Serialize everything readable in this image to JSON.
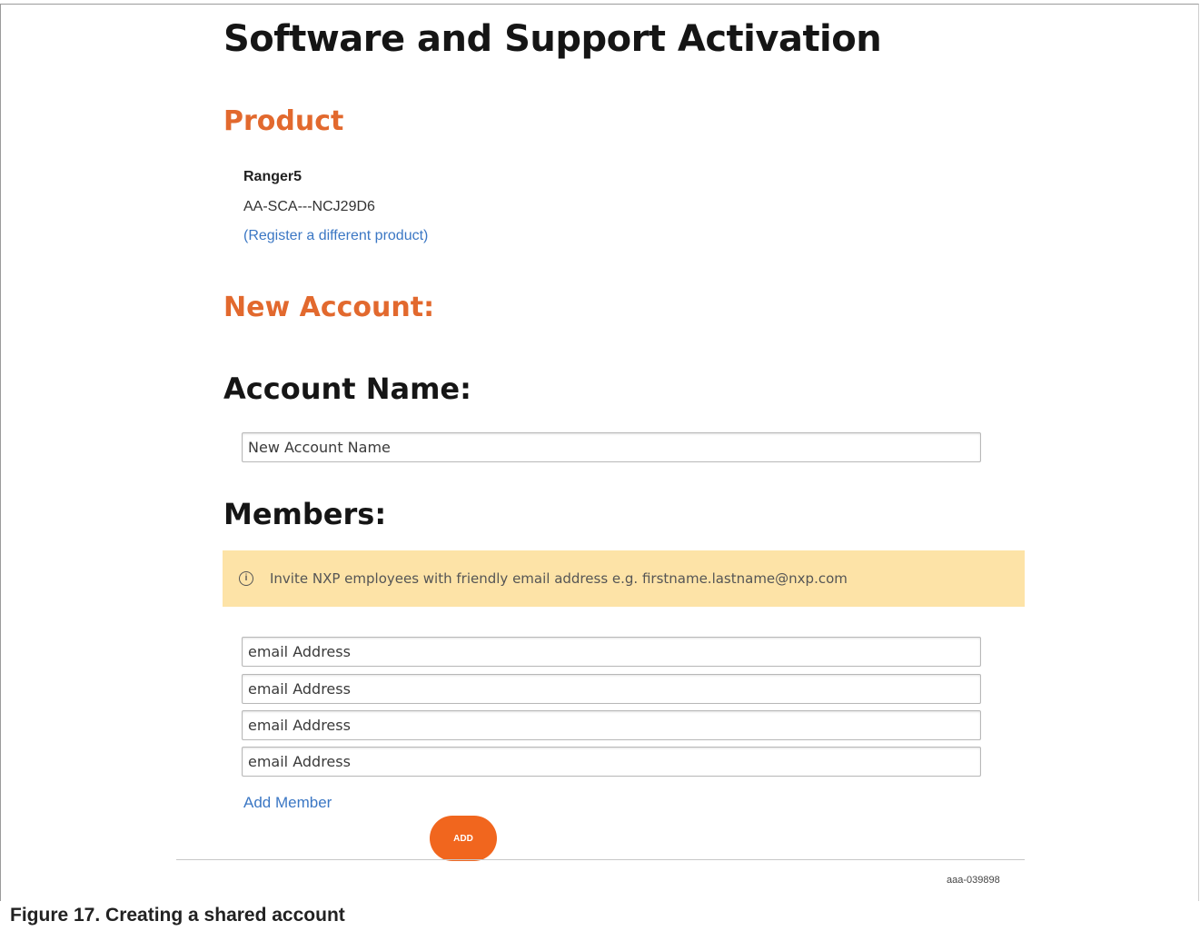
{
  "page": {
    "title": "Software and Support Activation"
  },
  "product": {
    "heading": "Product",
    "name": "Ranger5",
    "code": "AA-SCA---NCJ29D6",
    "change_link": "(Register a different product)"
  },
  "new_account": {
    "heading": "New Account:",
    "account_name_label": "Account Name:",
    "account_name_placeholder": "New Account Name"
  },
  "members": {
    "heading": "Members:",
    "notice_icon": "info-icon",
    "notice_text": "Invite NXP employees with friendly email address e.g. firstname.lastname@nxp.com",
    "email_placeholder": "email Address",
    "add_member_link": "Add Member",
    "add_button_label": "ADD"
  },
  "figure": {
    "id": "aaa-039898",
    "caption": "Figure 17.  Creating a shared account"
  },
  "colors": {
    "section_heading": "#e2692e",
    "link": "#3b77c4",
    "notice_bg": "#fde3a7",
    "add_button": "#f1661e"
  }
}
